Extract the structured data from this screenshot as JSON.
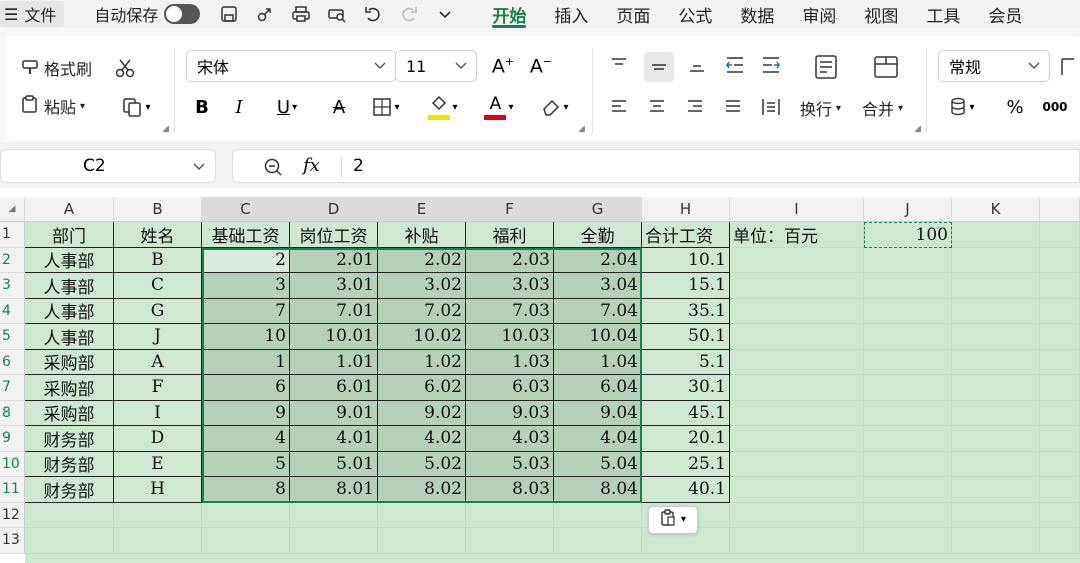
{
  "menubar": {
    "file_label": "文件",
    "autosave_label": "自动保存",
    "tabs": [
      "开始",
      "插入",
      "页面",
      "公式",
      "数据",
      "审阅",
      "视图",
      "工具",
      "会员"
    ]
  },
  "ribbon": {
    "format_painter": "格式刷",
    "paste": "粘贴",
    "font_name": "宋体",
    "font_size": "11",
    "wrap": "换行",
    "merge": "合并",
    "number_format": "常规",
    "percent": "%",
    "thousands": "000",
    "colors": {
      "highlight": "#f5e000",
      "font_color": "#e0001b"
    }
  },
  "formula_bar": {
    "cell_ref": "C2",
    "fx_label": "fx",
    "value": "2"
  },
  "sheet": {
    "columns": [
      "A",
      "B",
      "C",
      "D",
      "E",
      "F",
      "G",
      "H",
      "I",
      "J",
      "K"
    ],
    "row_numbers": [
      "1",
      "2",
      "3",
      "4",
      "5",
      "6",
      "7",
      "8",
      "9",
      "10",
      "11",
      "12",
      "13"
    ],
    "headers": [
      "部门",
      "姓名",
      "基础工资",
      "岗位工资",
      "补贴",
      "福利",
      "全勤",
      "合计工资"
    ],
    "unit_label": "单位：百元",
    "unit_value": "100",
    "rows": [
      [
        "人事部",
        "B",
        "2",
        "2.01",
        "2.02",
        "2.03",
        "2.04",
        "10.1"
      ],
      [
        "人事部",
        "C",
        "3",
        "3.01",
        "3.02",
        "3.03",
        "3.04",
        "15.1"
      ],
      [
        "人事部",
        "G",
        "7",
        "7.01",
        "7.02",
        "7.03",
        "7.04",
        "35.1"
      ],
      [
        "人事部",
        "J",
        "10",
        "10.01",
        "10.02",
        "10.03",
        "10.04",
        "50.1"
      ],
      [
        "采购部",
        "A",
        "1",
        "1.01",
        "1.02",
        "1.03",
        "1.04",
        "5.1"
      ],
      [
        "采购部",
        "F",
        "6",
        "6.01",
        "6.02",
        "6.03",
        "6.04",
        "30.1"
      ],
      [
        "采购部",
        "I",
        "9",
        "9.01",
        "9.02",
        "9.03",
        "9.04",
        "45.1"
      ],
      [
        "财务部",
        "D",
        "4",
        "4.01",
        "4.02",
        "4.03",
        "4.04",
        "20.1"
      ],
      [
        "财务部",
        "E",
        "5",
        "5.01",
        "5.02",
        "5.03",
        "5.04",
        "25.1"
      ],
      [
        "财务部",
        "H",
        "8",
        "8.01",
        "8.02",
        "8.03",
        "8.04",
        "40.1"
      ]
    ],
    "colors": {
      "sheet_bg": "#cfe8d3",
      "selection_fill": "#b5d0bb",
      "active_cell": "#d9ecdc",
      "accent": "#1a7f4a"
    }
  }
}
